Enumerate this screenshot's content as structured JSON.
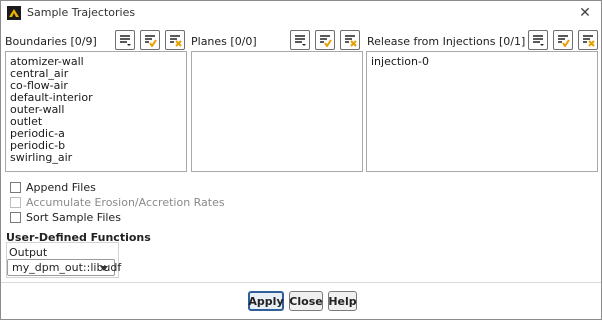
{
  "window": {
    "title": "Sample Trajectories"
  },
  "boundaries": {
    "label": "Boundaries [0/9]",
    "items": [
      "atomizer-wall",
      "central_air",
      "co-flow-air",
      "default-interior",
      "outer-wall",
      "outlet",
      "periodic-a",
      "periodic-b",
      "swirling_air"
    ]
  },
  "planes": {
    "label": "Planes [0/0]",
    "items": []
  },
  "injections": {
    "label": "Release from Injections [0/1]",
    "items": [
      "injection-0"
    ]
  },
  "options": {
    "append_files": "Append Files",
    "accumulate_erosion": "Accumulate Erosion/Accretion Rates",
    "sort_sample_files": "Sort Sample Files"
  },
  "udf": {
    "title": "User-Defined Functions",
    "output_label": "Output",
    "output_value": "my_dpm_out::libudf"
  },
  "buttons": {
    "apply": "Apply",
    "close": "Close",
    "help": "Help"
  },
  "icons": {
    "logo": "ansys-logo-icon",
    "close": "close-icon",
    "filter": "filter-list-icon",
    "select_all": "select-all-icon",
    "deselect_all": "deselect-all-icon"
  }
}
